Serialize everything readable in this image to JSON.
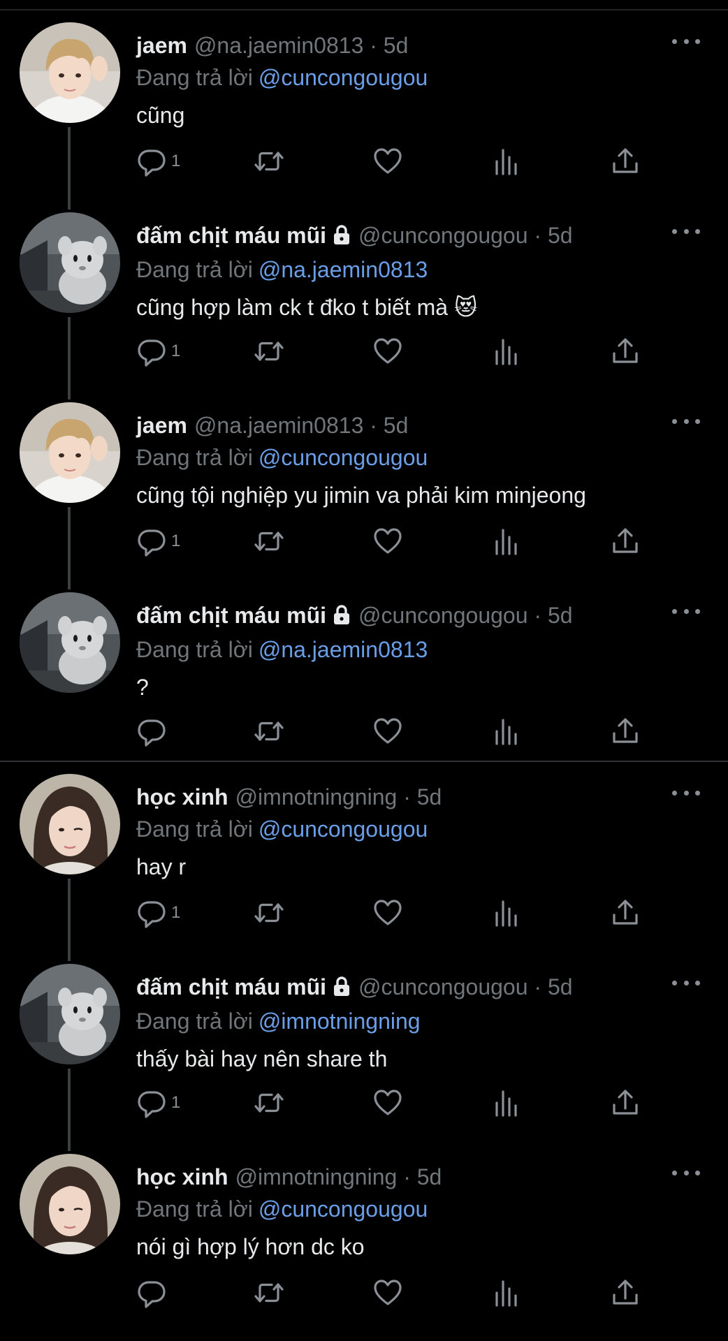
{
  "reply_prefix": "Đang trả lời",
  "threads": [
    [
      {
        "name": "jaem",
        "locked": false,
        "handle": "@na.jaemin0813",
        "time": "5d",
        "reply_to": "@cuncongougou",
        "text": "cũng",
        "reply_count": "1",
        "avatar": "jaem-avatar"
      },
      {
        "name": "đấm chịt máu mũi",
        "locked": true,
        "handle": "@cuncongougou",
        "time": "5d",
        "reply_to": "@na.jaemin0813",
        "text": "cũng hợp làm ck t đko t biết mà 😻",
        "reply_count": "1",
        "avatar": "plush-avatar"
      },
      {
        "name": "jaem",
        "locked": false,
        "handle": "@na.jaemin0813",
        "time": "5d",
        "reply_to": "@cuncongougou",
        "text": "cũng tội nghiệp yu jimin va phải kim minjeong",
        "reply_count": "1",
        "avatar": "jaem-avatar"
      },
      {
        "name": "đấm chịt máu mũi",
        "locked": true,
        "handle": "@cuncongougou",
        "time": "5d",
        "reply_to": "@na.jaemin0813",
        "text": "?",
        "reply_count": "",
        "avatar": "plush-avatar"
      }
    ],
    [
      {
        "name": "học xinh",
        "locked": false,
        "handle": "@imnotningning",
        "time": "5d",
        "reply_to": "@cuncongougou",
        "text": "hay r",
        "reply_count": "1",
        "avatar": "hocxinh-avatar"
      },
      {
        "name": "đấm chịt máu mũi",
        "locked": true,
        "handle": "@cuncongougou",
        "time": "5d",
        "reply_to": "@imnotningning",
        "text": "thấy bài hay nên share th",
        "reply_count": "1",
        "avatar": "plush-avatar"
      },
      {
        "name": "học xinh",
        "locked": false,
        "handle": "@imnotningning",
        "time": "5d",
        "reply_to": "@cuncongougou",
        "text": "nói gì hợp lý hơn dc ko",
        "reply_count": "",
        "avatar": "hocxinh-avatar"
      }
    ]
  ],
  "colors": {
    "background": "#000000",
    "text": "#e7e9ea",
    "muted": "#71767b",
    "mention": "#6a9fe8",
    "icon": "#8b9096"
  },
  "icons": [
    "reply-icon",
    "retweet-icon",
    "like-icon",
    "views-icon",
    "share-icon",
    "more-icon",
    "lock-icon"
  ]
}
